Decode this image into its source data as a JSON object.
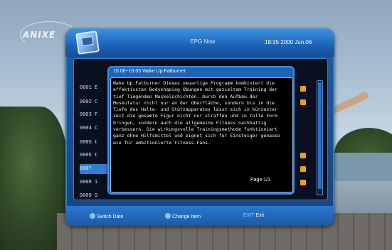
{
  "background": {
    "logo": "ANIXE"
  },
  "epg": {
    "title": "EPG Now",
    "clock": "18:35  2000 Jun.06",
    "channels": [
      {
        "label": "0001 E",
        "selected": false
      },
      {
        "label": "0002 C",
        "selected": false
      },
      {
        "label": "0003 F",
        "selected": false
      },
      {
        "label": "0004 C",
        "selected": false
      },
      {
        "label": "0005 t",
        "selected": false
      },
      {
        "label": "0006 t",
        "selected": false
      },
      {
        "label": "0007",
        "selected": true
      },
      {
        "label": "0008 i",
        "selected": false
      },
      {
        "label": "0009 S",
        "selected": false
      }
    ]
  },
  "footer": {
    "switch_date": "Switch Date",
    "change_item": "Change Item",
    "exit_key": "EXIT",
    "exit_label": "Exit"
  },
  "popup": {
    "title": "15:00~16:05  Wake Up:Fatburner",
    "description": "Wake Up:Fatburner Dieses neuartige Programm kombiniert die effektivsten Bodyshaping-Übungen mit gezieltem Training der tief liegenden Muskelschichten. Durch den Aufbau der Muskulatur nicht nur an der Oberfläche, sondern bis in die Tiefe des Halte- und Stützapparates lässt sich in kürzester Zeit die gesamte Figur nicht nur straffen und in tolle Form bringen, sondern auch die allgemeine Fitness nachhaltig verbessern. Die wirkungsvolle Trainingsmethode funktioniert ganz ohne Hilfsmittel und eignet sich für Einsteiger genauso wie für ambitionierte Fitness-Fans.",
    "page": "Page 1/1"
  },
  "colors": {
    "frame": "#1d5ea8",
    "selected_row": "#2f7fd6",
    "icon_orange": "#e8a21a"
  }
}
